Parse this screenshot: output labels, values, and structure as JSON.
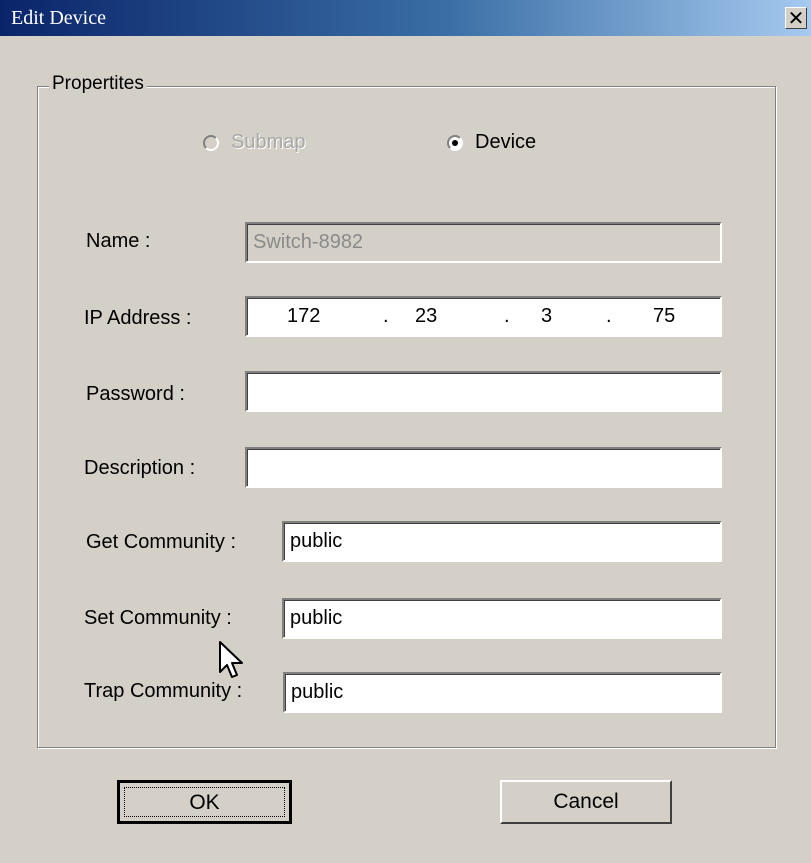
{
  "window": {
    "title": "Edit Device",
    "close_glyph": "✕"
  },
  "group": {
    "label": "Propertites"
  },
  "radios": [
    {
      "label": "Submap",
      "checked": false,
      "disabled": true
    },
    {
      "label": "Device",
      "checked": true,
      "disabled": false
    }
  ],
  "fields": {
    "name": {
      "label": "Name :",
      "value": "Switch-8982",
      "disabled": true
    },
    "ip": {
      "label": "IP Address :",
      "octets": [
        "172",
        "23",
        "3",
        "75"
      ],
      "separator": "."
    },
    "password": {
      "label": "Password :",
      "value": ""
    },
    "description": {
      "label": "Description :",
      "value": ""
    },
    "get_community": {
      "label": "Get Community :",
      "value": "public"
    },
    "set_community": {
      "label": "Set Community :",
      "value": "public"
    },
    "trap_community": {
      "label": "Trap Community :",
      "value": "public"
    }
  },
  "buttons": {
    "ok": "OK",
    "cancel": "Cancel"
  },
  "icons": {
    "cursor": "arrow-cursor-icon",
    "close": "close-icon"
  }
}
